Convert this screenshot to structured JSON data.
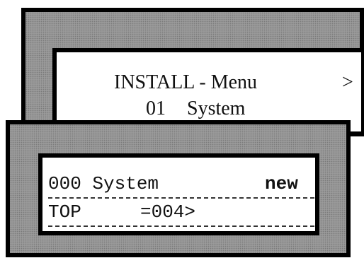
{
  "install_display": {
    "title": "INSTALL - Menu",
    "arrow": ">",
    "item_number": "01",
    "item_name": "System"
  },
  "system_display": {
    "line1": {
      "label": "000 System",
      "status": "new"
    },
    "line2": {
      "label": "TOP",
      "value": "=004>"
    }
  }
}
